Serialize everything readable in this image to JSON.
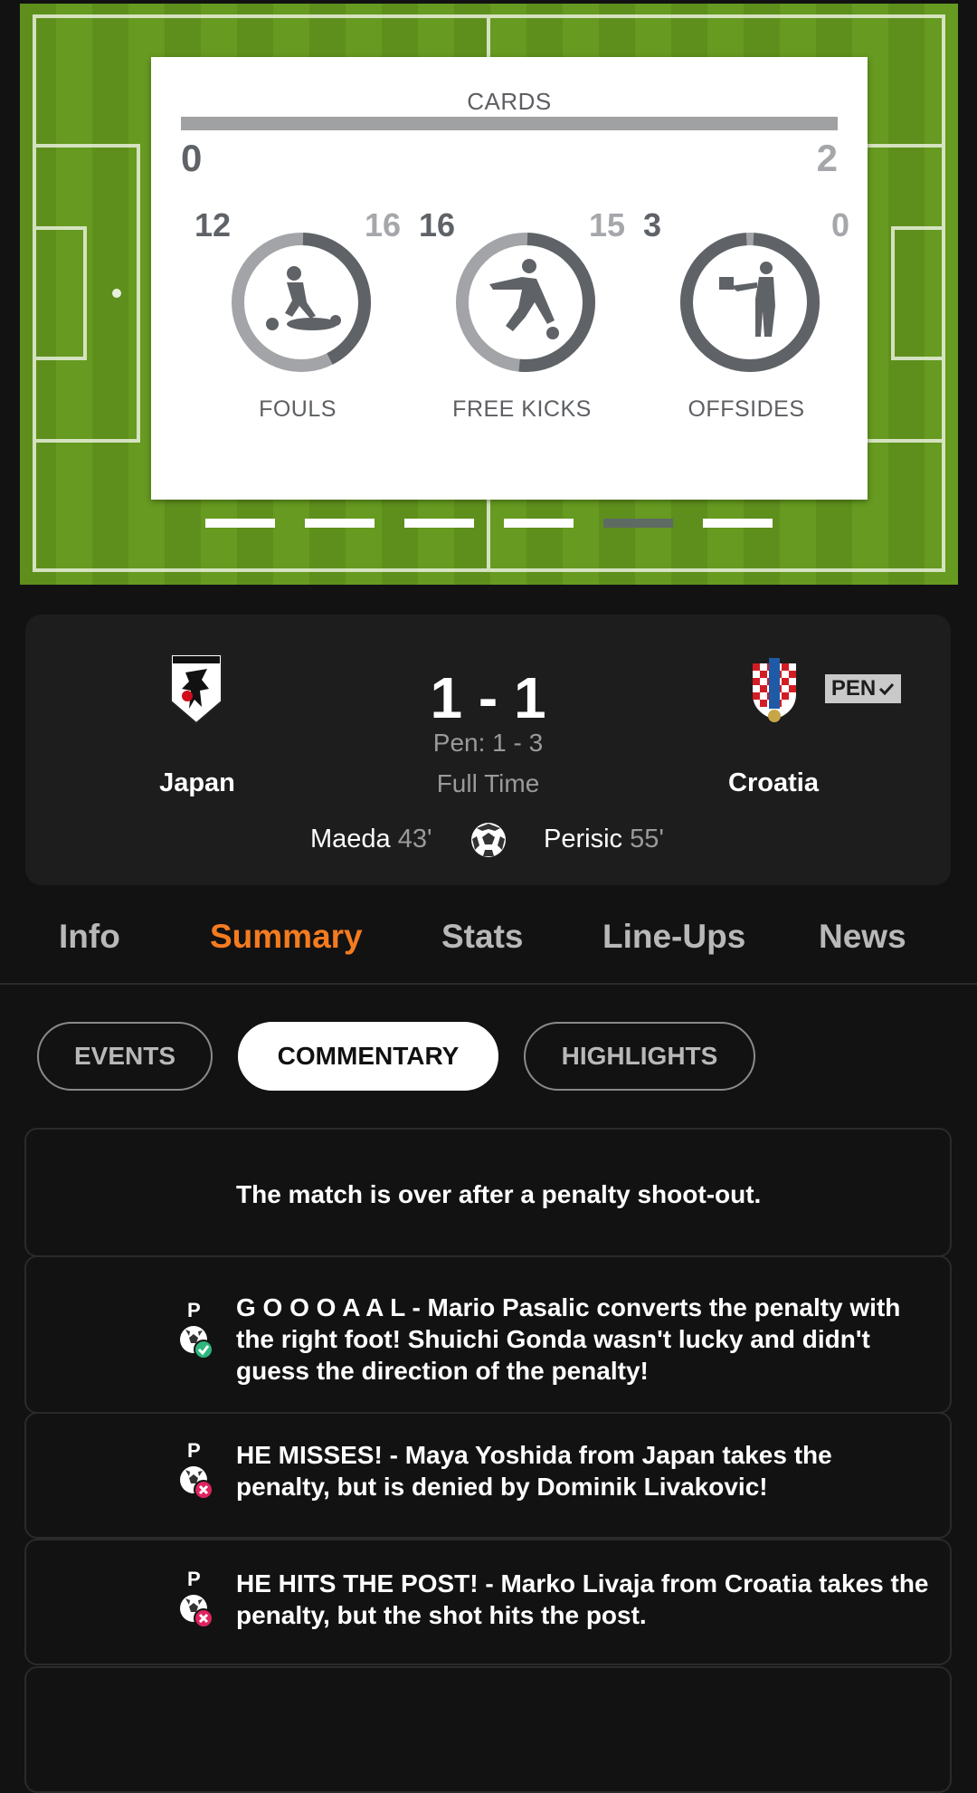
{
  "stats_card": {
    "cards": {
      "title": "CARDS",
      "home": "0",
      "away": "2"
    },
    "items": [
      {
        "label": "FOULS",
        "home": "12",
        "away": "16",
        "home_share": 0.43,
        "icon": "foul-icon"
      },
      {
        "label": "FREE KICKS",
        "home": "16",
        "away": "15",
        "home_share": 0.52,
        "icon": "free-kick-icon"
      },
      {
        "label": "OFFSIDES",
        "home": "3",
        "away": "0",
        "home_share": 1.0,
        "icon": "offside-icon"
      }
    ],
    "pager": {
      "count": 6,
      "active_index": 4
    }
  },
  "match": {
    "home": {
      "name": "Japan",
      "crest": "japan-crest-icon"
    },
    "away": {
      "name": "Croatia",
      "crest": "croatia-crest-icon"
    },
    "score": "1 - 1",
    "penalties": "Pen: 1 - 3",
    "status": "Full Time",
    "pen_badge": "PEN",
    "home_scorer": {
      "name": "Maeda",
      "minute": "43'"
    },
    "away_scorer": {
      "name": "Perisic",
      "minute": "55'"
    }
  },
  "tabs": [
    "Info",
    "Summary",
    "Stats",
    "Line-Ups",
    "News"
  ],
  "active_tab": "Summary",
  "chips": [
    "EVENTS",
    "COMMENTARY",
    "HIGHLIGHTS"
  ],
  "active_chip": "COMMENTARY",
  "commentary": [
    {
      "text": "The match is over after a penalty shoot-out.",
      "marker": ""
    },
    {
      "text": "G O O O A A L - Mario Pasalic converts the penalty with the right foot! Shuichi Gonda wasn't lucky and didn't guess the direction of the penalty!",
      "marker": "P",
      "result": "scored"
    },
    {
      "text": "HE MISSES! - Maya Yoshida from Japan takes the penalty, but is denied by Dominik Livakovic!",
      "marker": "P",
      "result": "missed"
    },
    {
      "text": "HE HITS THE POST! - Marko Livaja from Croatia takes the penalty, but the shot hits the post.",
      "marker": "P",
      "result": "missed"
    }
  ],
  "colors": {
    "accent": "#f47b20",
    "pitch": "#669a20",
    "scored": "#2eb67d",
    "missed": "#e0245e"
  }
}
